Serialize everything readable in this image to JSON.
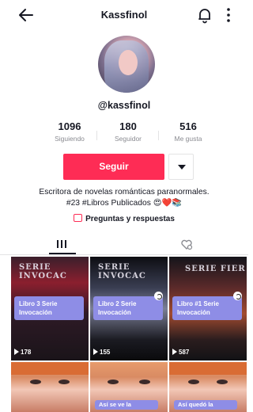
{
  "header": {
    "title": "Kassfinol"
  },
  "profile": {
    "username": "@kassfinol",
    "stats": [
      {
        "value": "1096",
        "label": "Siguiendo"
      },
      {
        "value": "180",
        "label": "Seguidor"
      },
      {
        "value": "516",
        "label": "Me gusta"
      }
    ],
    "follow_label": "Seguir",
    "bio_line1": "Escritora de novelas románticas paranormales.",
    "bio_line2": "#23 #Libros Publicados 😍❤️📚",
    "qa_label": "Preguntas y respuestas"
  },
  "videos": [
    {
      "label_line1": "Libro 3 Serie",
      "label_line2": "Invocación",
      "views": "178",
      "cover_text": "SERIE INVOCAC"
    },
    {
      "label_line1": "Libro 2 Serie",
      "label_line2": "Invocación",
      "views": "155",
      "cover_text": "SERIE INVOCAC"
    },
    {
      "label_line1": "Libro #1 Serie",
      "label_line2": "Invocación",
      "views": "587",
      "cover_text": "SERIE FIER"
    },
    {
      "caption": ""
    },
    {
      "caption": "Así se ve la"
    },
    {
      "caption": "Así quedó la"
    }
  ],
  "colors": {
    "accent": "#fe2c55",
    "label_bg": "#8e8de6",
    "text": "#161823",
    "muted": "#8a8b91"
  }
}
